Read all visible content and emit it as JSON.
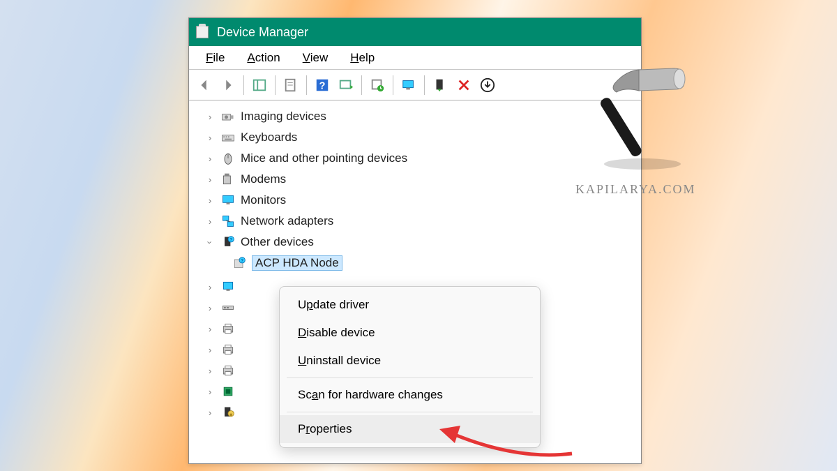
{
  "window": {
    "title": "Device Manager"
  },
  "menubar": {
    "file": "File",
    "action": "Action",
    "view": "View",
    "help": "Help"
  },
  "tree": {
    "items": [
      {
        "label": "Imaging devices",
        "icon": "camera"
      },
      {
        "label": "Keyboards",
        "icon": "keyboard"
      },
      {
        "label": "Mice and other pointing devices",
        "icon": "mouse"
      },
      {
        "label": "Modems",
        "icon": "modem"
      },
      {
        "label": "Monitors",
        "icon": "monitor"
      },
      {
        "label": "Network adapters",
        "icon": "network"
      }
    ],
    "expanded": {
      "label": "Other devices",
      "icon": "other",
      "child": "ACP HDA Node"
    },
    "below_icons": [
      "pc",
      "port",
      "printer",
      "printer2",
      "printer3",
      "cpu",
      "security"
    ]
  },
  "context_menu": {
    "update": "Update driver",
    "disable": "Disable device",
    "uninstall": "Uninstall device",
    "scan": "Scan for hardware changes",
    "properties": "Properties"
  },
  "watermark": {
    "text": "KAPILARYA.COM"
  }
}
